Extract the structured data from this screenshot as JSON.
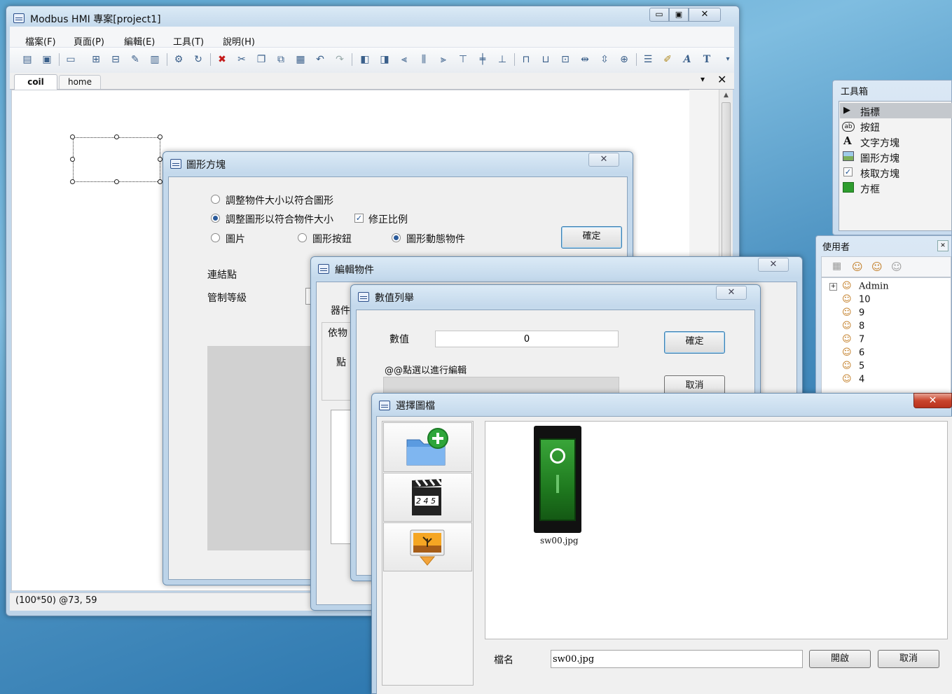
{
  "main_window": {
    "title": "Modbus HMI 專案[project1]",
    "menu": [
      "檔案(F)",
      "頁面(P)",
      "編輯(E)",
      "工具(T)",
      "說明(H)"
    ],
    "tabs": [
      "coil",
      "home"
    ],
    "status": "(100*50) @73, 59"
  },
  "toolbox": {
    "title": "工具箱",
    "items": [
      {
        "label": "指標",
        "icon": "pointer-icon"
      },
      {
        "label": "按鈕",
        "icon": "button-ab-icon"
      },
      {
        "label": "文字方塊",
        "icon": "text-a-icon"
      },
      {
        "label": "圖形方塊",
        "icon": "picture-icon"
      },
      {
        "label": "核取方塊",
        "icon": "checkbox-icon"
      },
      {
        "label": "方框",
        "icon": "green-square-icon"
      }
    ]
  },
  "users_panel": {
    "title": "使用者",
    "users": [
      "Admin",
      "10",
      "9",
      "8",
      "7",
      "6",
      "5",
      "4"
    ]
  },
  "graphic_box_dialog": {
    "title": "圖形方塊",
    "options": {
      "resize_object": "調整物件大小以符合圖形",
      "resize_image": "調整圖形以符合物件大小",
      "keep_ratio": "修正比例",
      "picture": "圖片",
      "graphic_button": "圖形按鈕",
      "graphic_dynamic": "圖形動態物件"
    },
    "ok_label": "確定",
    "link_point": "連結點",
    "control_level": "管制等級"
  },
  "edit_object_dialog": {
    "title": "編輯物件",
    "device_label": "器件",
    "by_object": "依物",
    "point_label": "點"
  },
  "value_list_dialog": {
    "title": "數值列舉",
    "value_label": "數值",
    "value": "0",
    "hint": "@@點選以進行編輯",
    "ok_label": "確定",
    "cancel_label": "取消"
  },
  "select_image_dialog": {
    "title": "選擇圖檔",
    "file_caption": "sw00.jpg",
    "filename_label": "檔名",
    "filename_value": "sw00.jpg",
    "open_label": "開啟",
    "cancel_label": "取消"
  }
}
